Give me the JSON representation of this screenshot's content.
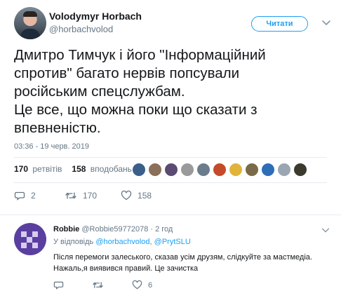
{
  "tweet": {
    "author_name": "Volodymyr Horbach",
    "author_handle": "@horbachvolod",
    "follow_label": "Читати",
    "text_lines": [
      "Дмитро Тимчук і його \"Інформаційний",
      "спротив\" багато нервів попсували",
      "російським спецслужбам.",
      "Це все, що можна поки що сказати з",
      "впевненістю."
    ],
    "timestamp": "03:36 - 19 черв. 2019",
    "stats": {
      "retweets_count": "170",
      "retweets_label": "ретвітів",
      "likes_count": "158",
      "likes_label": "вподобань"
    },
    "likers": [
      {
        "icon": "liker-avatar",
        "color": "#3a5f8a"
      },
      {
        "icon": "liker-avatar",
        "color": "#8a6f5a"
      },
      {
        "icon": "liker-avatar",
        "color": "#5b4a72"
      },
      {
        "icon": "liker-avatar",
        "color": "#9a9a9a"
      },
      {
        "icon": "liker-avatar",
        "color": "#6b7d8c"
      },
      {
        "icon": "liker-avatar",
        "color": "#c44b2a"
      },
      {
        "icon": "liker-avatar",
        "color": "#e0b43a"
      },
      {
        "icon": "liker-avatar",
        "color": "#7a6a4a"
      },
      {
        "icon": "liker-avatar",
        "color": "#2e6db8"
      },
      {
        "icon": "liker-avatar",
        "color": "#9aa7b2"
      },
      {
        "icon": "liker-avatar",
        "color": "#3a3a2e"
      }
    ],
    "actions": {
      "reply_count": "2",
      "retweet_count": "170",
      "like_count": "158"
    }
  },
  "reply": {
    "author_name": "Robbie",
    "author_handle": "@Robbie59772078",
    "separator": "·",
    "time": "2 год",
    "reply_to_prefix": "У відповідь",
    "reply_to_handles": [
      "@horbachvolod",
      "@PrytSLU"
    ],
    "reply_to_joiner": ",",
    "text_lines": [
      "Після перемоги залеського, сказав усім друзям, слідкуйте за мастмедіа.",
      "Нажаль,я виявився правий. Це зачистка"
    ],
    "actions": {
      "like_count": "6"
    }
  },
  "colors": {
    "accent": "#1da1f2",
    "secondary_text": "#657786",
    "border": "#e6ecf0"
  }
}
